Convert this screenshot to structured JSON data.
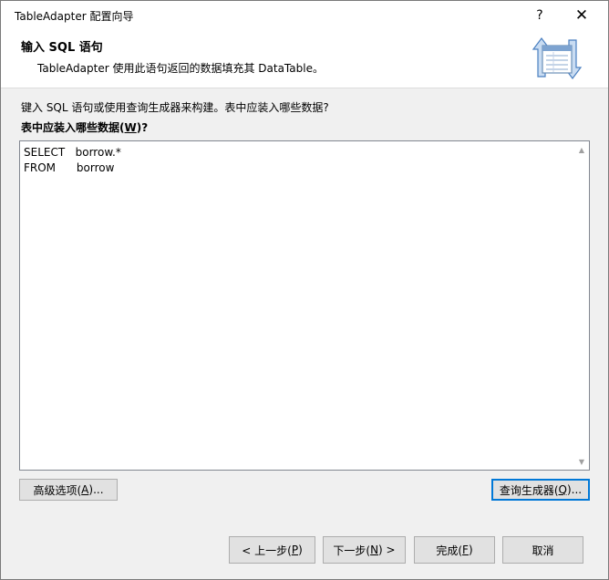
{
  "window": {
    "title": "TableAdapter 配置向导",
    "help_glyph": "?",
    "close_glyph": "✕"
  },
  "header": {
    "title": "输入 SQL 语句",
    "description": "TableAdapter 使用此语句返回的数据填充其 DataTable。",
    "icon": "table-adapter-icon"
  },
  "main": {
    "prompt": "键入 SQL 语句或使用查询生成器来构建。表中应装入哪些数据?",
    "sql_label": {
      "text": "表中应装入哪些数据(",
      "mnemonic": "W",
      "suffix": ")?"
    },
    "sql_text": "SELECT   borrow.*\nFROM      borrow",
    "advanced_button": {
      "text": "高级选项(",
      "mnemonic": "A",
      "suffix": ")..."
    },
    "query_builder_button": {
      "text": "查询生成器(",
      "mnemonic": "Q",
      "suffix": ")..."
    }
  },
  "footer": {
    "back_button": {
      "text": "< 上一步(",
      "mnemonic": "P",
      "suffix": ")"
    },
    "next_button": {
      "text": "下一步(",
      "mnemonic": "N",
      "suffix": ") >"
    },
    "finish_button": {
      "text": "完成(",
      "mnemonic": "F",
      "suffix": ")"
    },
    "cancel_button": "取消"
  },
  "colors": {
    "accent": "#0078d7",
    "background": "#f0f0f0",
    "button_face": "#e1e1e1"
  }
}
